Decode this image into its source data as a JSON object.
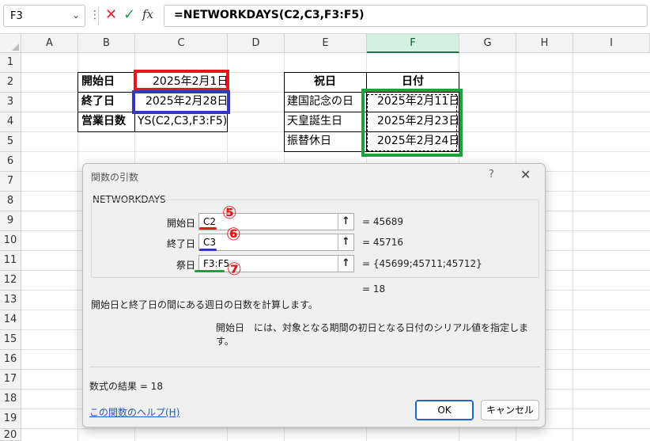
{
  "formula_bar": {
    "name_box": "F3",
    "fx": "fx",
    "formula": "=NETWORKDAYS(C2,C3,F3:F5)"
  },
  "columns": [
    "A",
    "B",
    "C",
    "D",
    "E",
    "F",
    "G",
    "H",
    "I"
  ],
  "rows": [
    "1",
    "2",
    "3",
    "4",
    "5",
    "6",
    "7",
    "8",
    "9",
    "10",
    "11",
    "12",
    "13",
    "14",
    "15",
    "16",
    "17",
    "18",
    "19",
    "20"
  ],
  "sheet": {
    "b2": "開始日",
    "c2": "2025年2月1日",
    "b3": "終了日",
    "c3": "2025年2月28日",
    "b4": "営業日数",
    "c4": "YS(C2,C3,F3:F5)",
    "e2": "祝日",
    "f2": "日付",
    "e3": "建国記念の日",
    "f3": "2025年2月11日",
    "e4": "天皇誕生日",
    "f4": "2025年2月23日",
    "e5": "振替休日",
    "f5": "2025年2月24日"
  },
  "highlight_colors": {
    "red": "#e8161b",
    "blue": "#3339b8",
    "green": "#1aa33a"
  },
  "dialog": {
    "title": "関数の引数",
    "help_glyph": "?",
    "close_glyph": "✕",
    "function_name": "NETWORKDAYS",
    "args": [
      {
        "label": "開始日",
        "value": "C2",
        "result": "=   45689",
        "marker": "⑤"
      },
      {
        "label": "終了日",
        "value": "C3",
        "result": "=   45716",
        "marker": "⑥"
      },
      {
        "label": "祭日",
        "value": "F3:F5",
        "result": "=   {45699;45711;45712}",
        "marker": "⑦"
      }
    ],
    "total_result": "=   18",
    "description": "開始日と終了日の間にある週日の日数を計算します。",
    "arg_desc_name": "開始日",
    "arg_desc_text": "には、対象となる期間の初日となる日付のシリアル値を指定します。",
    "formula_result": "数式の結果 =   18",
    "help_link": "この関数のヘルプ(H)",
    "ok_label": "OK",
    "cancel_label": "キャンセル"
  }
}
